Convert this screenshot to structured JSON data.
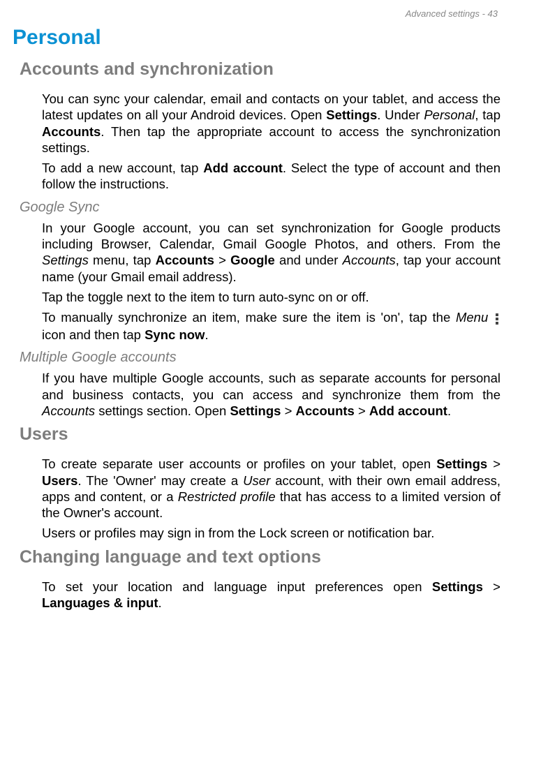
{
  "header": "Advanced settings - 43",
  "h1_personal": "Personal",
  "h2_accounts": "Accounts and synchronization",
  "p_sync_intro": {
    "a": "You can sync your calendar, email and contacts on your tablet, and access the latest updates on all your Android devices. Open ",
    "b": "Settings",
    "c": ". Under ",
    "d": "Personal",
    "e": ", tap ",
    "f": "Accounts",
    "g": ". Then tap the appropriate account to access the synchronization settings."
  },
  "p_add_account": {
    "a": "To add a new account, tap ",
    "b": "Add account",
    "c": ". Select the type of account and then follow the instructions."
  },
  "h3_google_sync": "Google Sync",
  "p_google_sync": {
    "a": "In your Google account, you can set synchronization for Google products including Browser, Calendar, Gmail Google Photos, and others. From the ",
    "b": "Settings",
    "c": " menu, tap ",
    "d": "Accounts",
    "e": " > ",
    "f": "Google",
    "g": " and under ",
    "h": "Accounts",
    "i": ", tap your account name (your Gmail email address)."
  },
  "p_toggle": "Tap the toggle next to the item to turn auto-sync on or off.",
  "p_manual_sync": {
    "a": "To manually synchronize an item, make sure the item is 'on', tap the ",
    "b": "Menu",
    "c": " icon and then tap ",
    "d": "Sync now",
    "e": "."
  },
  "h3_multiple": "Multiple Google accounts",
  "p_multiple": {
    "a": "If you have multiple Google accounts, such as separate accounts for personal and business contacts, you can access and synchronize them from the ",
    "b": "Accounts",
    "c": " settings section. Open ",
    "d": "Settings",
    "e": " > ",
    "f": "Accounts",
    "g": " > ",
    "h": "Add account",
    "i": "."
  },
  "h2_users": "Users",
  "p_users1": {
    "a": "To create separate user accounts or profiles on your tablet, open ",
    "b": "Settings",
    "c": " > ",
    "d": "Users",
    "e": ". The 'Owner' may create a ",
    "f": "User",
    "g": " account, with their own email address, apps and content, or a ",
    "h": "Restricted profile",
    "i": " that has access to a limited version of the Owner's account."
  },
  "p_users2": "Users or profiles may sign in from the Lock screen or notification bar.",
  "h2_language": "Changing language and text options",
  "p_language": {
    "a": "To set your location and language input preferences open ",
    "b": "Settings",
    "c": " > ",
    "d": "Languages & input",
    "e": "."
  }
}
